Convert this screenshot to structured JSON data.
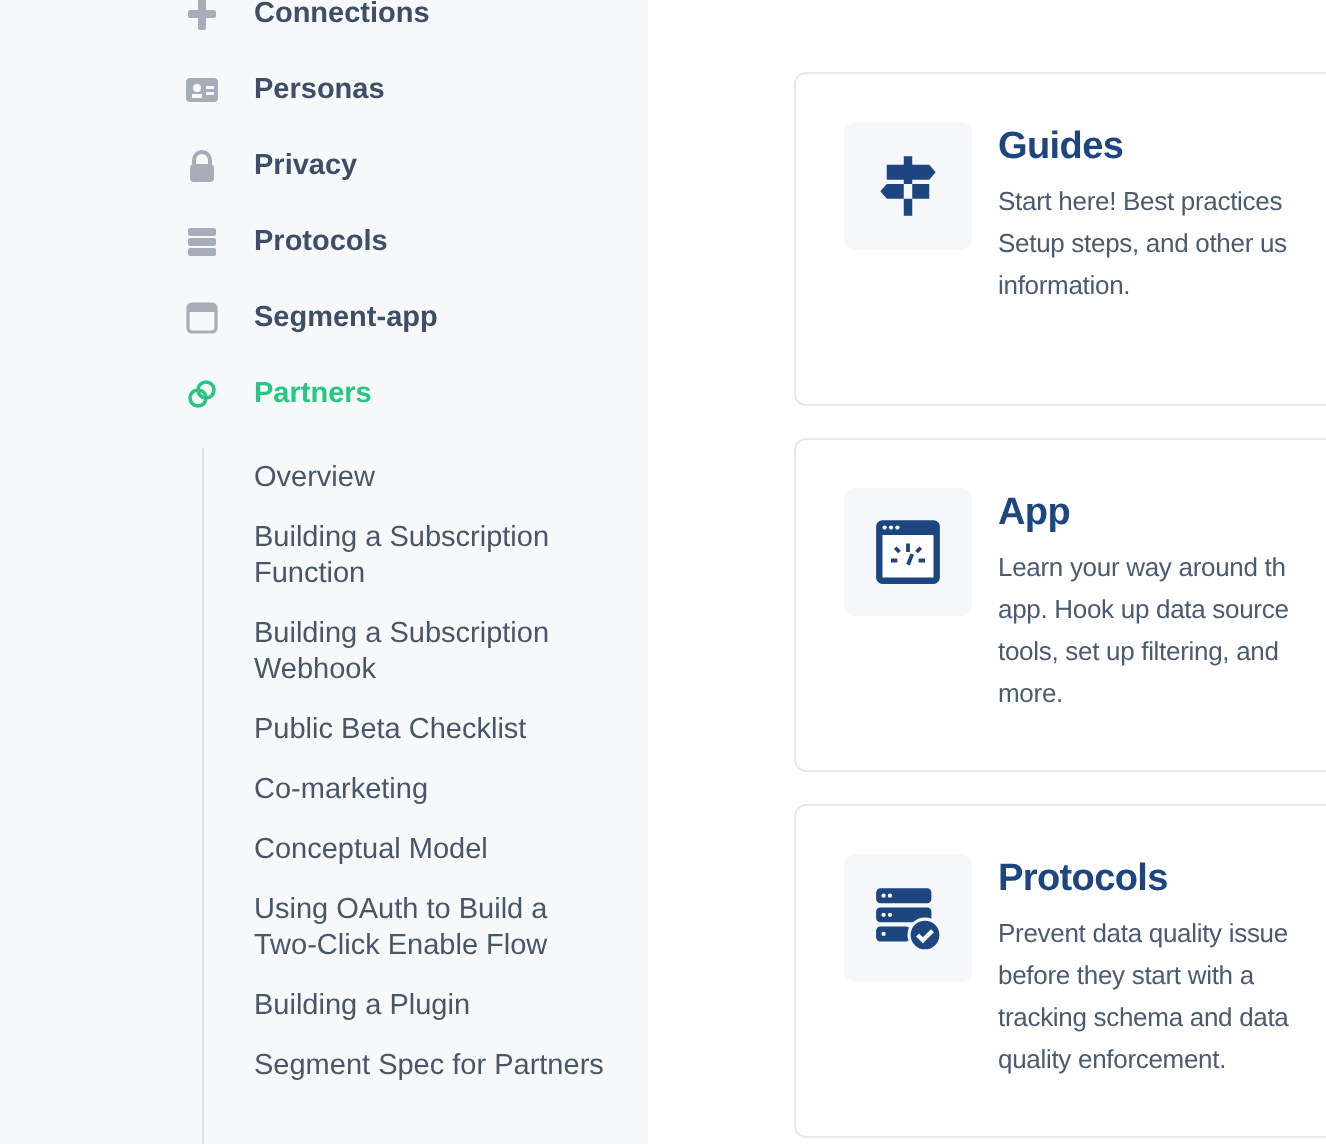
{
  "sidebar": {
    "items": [
      {
        "label": "Connections",
        "selected": false
      },
      {
        "label": "Personas",
        "selected": false
      },
      {
        "label": "Privacy",
        "selected": false
      },
      {
        "label": "Protocols",
        "selected": false
      },
      {
        "label": "Segment-app",
        "selected": false
      },
      {
        "label": "Partners",
        "selected": true,
        "expanded": true,
        "children": [
          {
            "label": "Overview"
          },
          {
            "label": "Building a Subscription Function"
          },
          {
            "label": "Building a Subscription Webhook"
          },
          {
            "label": "Public Beta Checklist"
          },
          {
            "label": "Co-marketing"
          },
          {
            "label": "Conceptual Model"
          },
          {
            "label": "Using OAuth to Build a Two-Click Enable Flow"
          },
          {
            "label": "Building a Plugin"
          },
          {
            "label": "Segment Spec for Partners"
          }
        ]
      }
    ]
  },
  "cards": [
    {
      "title": "Guides",
      "description": [
        "Start here! Best practices",
        "Setup steps, and other us",
        "information."
      ]
    },
    {
      "title": "App",
      "description": [
        "Learn your way around th",
        "app. Hook up data source",
        "tools, set up filtering, and",
        "more."
      ]
    },
    {
      "title": "Protocols",
      "description": [
        "Prevent data quality issue",
        "before they start with a",
        "tracking schema and data",
        "quality enforcement."
      ]
    }
  ]
}
